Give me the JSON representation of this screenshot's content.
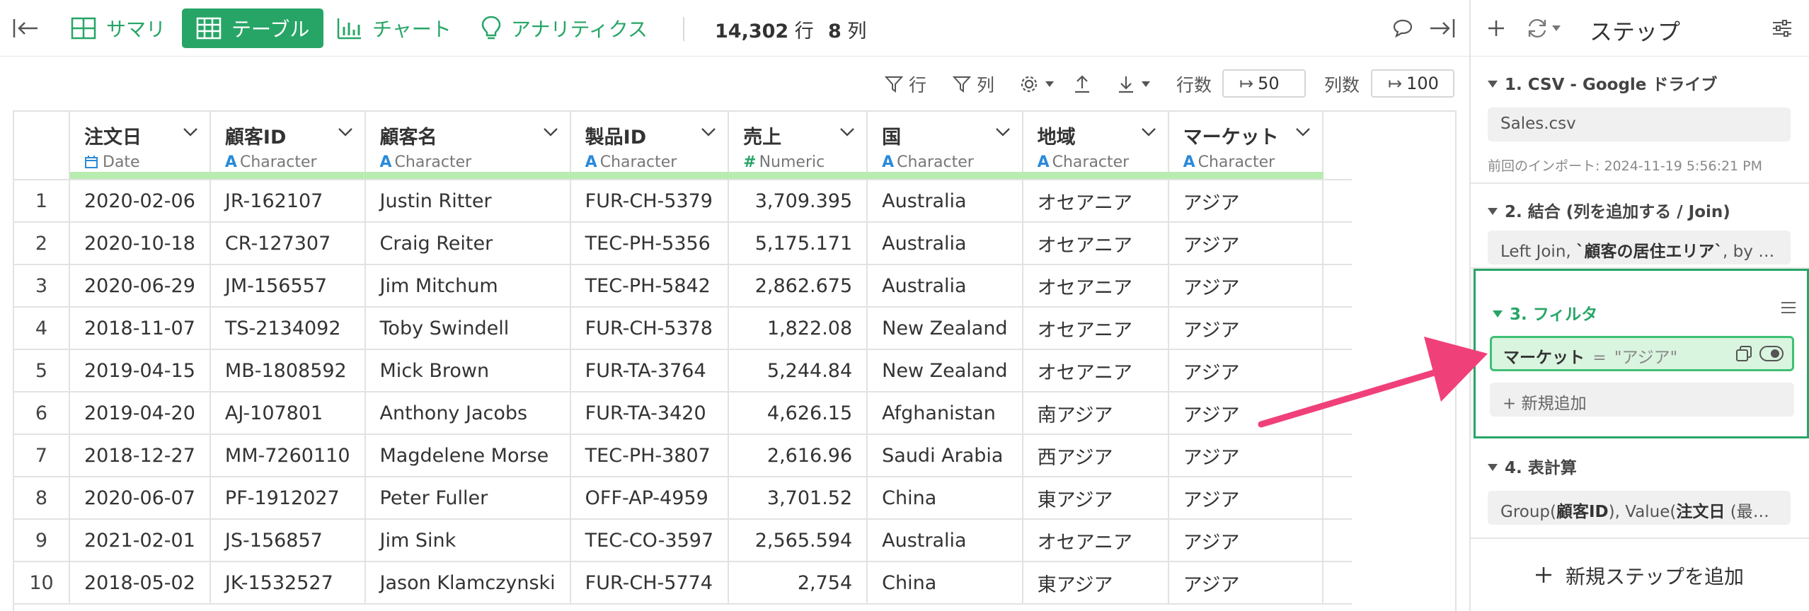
{
  "toolbar": {
    "tabs": [
      {
        "label": "サマリ",
        "icon": "summary-grid-icon"
      },
      {
        "label": "テーブル",
        "icon": "table-icon",
        "active": true
      },
      {
        "label": "チャート",
        "icon": "bar-chart-icon"
      },
      {
        "label": "アナリティクス",
        "icon": "lightbulb-icon"
      }
    ],
    "row_count": "14,302",
    "row_unit": "行",
    "col_count": "8",
    "col_unit": "列"
  },
  "subbar": {
    "filter_row_label": "行",
    "filter_col_label": "列",
    "rows_label": "行数",
    "rows_value": "50",
    "cols_label": "列数",
    "cols_value": "100"
  },
  "table": {
    "columns": [
      {
        "name": "注文日",
        "type": "Date",
        "type_icon": "calendar-icon"
      },
      {
        "name": "顧客ID",
        "type": "Character",
        "type_icon": "A"
      },
      {
        "name": "顧客名",
        "type": "Character",
        "type_icon": "A"
      },
      {
        "name": "製品ID",
        "type": "Character",
        "type_icon": "A"
      },
      {
        "name": "売上",
        "type": "Numeric",
        "type_icon": "#"
      },
      {
        "name": "国",
        "type": "Character",
        "type_icon": "A"
      },
      {
        "name": "地域",
        "type": "Character",
        "type_icon": "A"
      },
      {
        "name": "マーケット",
        "type": "Character",
        "type_icon": "A"
      }
    ],
    "rows": [
      [
        "1",
        "2020-02-06",
        "JR-162107",
        "Justin Ritter",
        "FUR-CH-5379",
        "3,709.395",
        "Australia",
        "オセアニア",
        "アジア"
      ],
      [
        "2",
        "2020-10-18",
        "CR-127307",
        "Craig Reiter",
        "TEC-PH-5356",
        "5,175.171",
        "Australia",
        "オセアニア",
        "アジア"
      ],
      [
        "3",
        "2020-06-29",
        "JM-156557",
        "Jim Mitchum",
        "TEC-PH-5842",
        "2,862.675",
        "Australia",
        "オセアニア",
        "アジア"
      ],
      [
        "4",
        "2018-11-07",
        "TS-2134092",
        "Toby Swindell",
        "FUR-CH-5378",
        "1,822.08",
        "New Zealand",
        "オセアニア",
        "アジア"
      ],
      [
        "5",
        "2019-04-15",
        "MB-1808592",
        "Mick Brown",
        "FUR-TA-3764",
        "5,244.84",
        "New Zealand",
        "オセアニア",
        "アジア"
      ],
      [
        "6",
        "2019-04-20",
        "AJ-107801",
        "Anthony Jacobs",
        "FUR-TA-3420",
        "4,626.15",
        "Afghanistan",
        "南アジア",
        "アジア"
      ],
      [
        "7",
        "2018-12-27",
        "MM-7260110",
        "Magdelene Morse",
        "TEC-PH-3807",
        "2,616.96",
        "Saudi Arabia",
        "西アジア",
        "アジア"
      ],
      [
        "8",
        "2020-06-07",
        "PF-1912027",
        "Peter Fuller",
        "OFF-AP-4959",
        "3,701.52",
        "China",
        "東アジア",
        "アジア"
      ],
      [
        "9",
        "2021-02-01",
        "JS-156857",
        "Jim Sink",
        "TEC-CO-3597",
        "2,565.594",
        "Australia",
        "オセアニア",
        "アジア"
      ],
      [
        "10",
        "2018-05-02",
        "JK-1532527",
        "Jason Klamczynski",
        "FUR-CH-5774",
        "2,754",
        "China",
        "東アジア",
        "アジア"
      ]
    ]
  },
  "panel": {
    "title": "ステップ",
    "steps": [
      {
        "title": "1. CSV - Google ドライブ",
        "box": "Sales.csv",
        "meta": "前回のインポート: 2024-11-19 5:56:21 PM"
      },
      {
        "title": "2. 結合 (列を追加する / Join)",
        "box_pre": "Left Join, ",
        "box_bold": "`顧客の居住エリア`",
        "box_post": ", by = j..."
      },
      {
        "title": "3. フィルタ",
        "filter_col": "マーケット",
        "filter_op": "=",
        "filter_val": "\"アジア\"",
        "add_label": "+ 新規追加"
      },
      {
        "title": "4. 表計算",
        "box_a": "Group(",
        "box_b": "顧客ID",
        "box_c": "), Value(",
        "box_d": "注文日",
        "box_e": " (最初の..."
      }
    ],
    "add_step": "新規ステップを追加"
  },
  "colors": {
    "accent": "#27a567",
    "arrow": "#f0407a",
    "quality_bar": "#b8ecb0"
  }
}
